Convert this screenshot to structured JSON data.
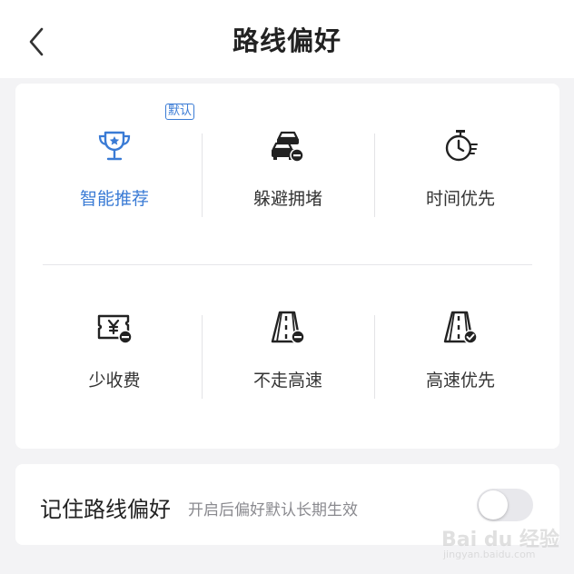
{
  "header": {
    "title": "路线偏好",
    "back_icon": "chevron-left-icon"
  },
  "options": [
    {
      "label": "智能推荐",
      "icon": "trophy-icon",
      "active": true,
      "badge": "默认"
    },
    {
      "label": "躲避拥堵",
      "icon": "cars-minus-icon",
      "active": false
    },
    {
      "label": "时间优先",
      "icon": "stopwatch-icon",
      "active": false
    },
    {
      "label": "少收费",
      "icon": "toll-ticket-minus-icon",
      "active": false
    },
    {
      "label": "不走高速",
      "icon": "highway-minus-icon",
      "active": false
    },
    {
      "label": "高速优先",
      "icon": "highway-check-icon",
      "active": false
    }
  ],
  "remember": {
    "title": "记住路线偏好",
    "subtitle": "开启后偏好默认长期生效",
    "toggle_on": false
  },
  "watermark": {
    "brand": "Bai du 经验",
    "url": "jingyan.baidu.com"
  },
  "colors": {
    "accent": "#3a7bd5",
    "icon": "#222222",
    "text": "#333333",
    "muted": "#8a8a8f"
  }
}
